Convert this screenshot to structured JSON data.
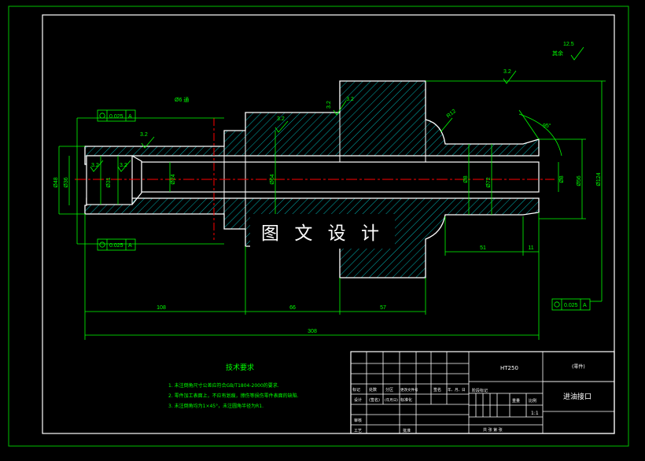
{
  "colors": {
    "outline": "#ffffff",
    "dimension": "#00ff00",
    "hatch": "#00b0b0",
    "centerline": "#ff0000",
    "frame": "#00c000",
    "block": "#ffffff",
    "background": "#000000"
  },
  "watermark": "图 文 设 计",
  "dimensions": {
    "d108": "108",
    "d66": "66",
    "d57": "57",
    "d308": "308",
    "d51": "51",
    "d11": "11",
    "dia_left": "Ø48",
    "dia_bore": "Ø36",
    "dia_inner": "Ø31",
    "dia_24": "Ø24",
    "dia_64": "Ø64",
    "dia_8a": "Ø8",
    "dia_72": "Ø72",
    "dia_8b": "Ø8",
    "dia_56": "Ø56",
    "dia_124": "Ø124",
    "hole": "Ø6 通",
    "angle": "95°",
    "radius": "R12"
  },
  "roughness": {
    "r1": "3.2",
    "r2": "3.2",
    "r3": "3.2",
    "r4": "3.2",
    "r5": "3.2",
    "r6": "3.2",
    "r7": "3.2",
    "other": "12.5",
    "other_label": "其余"
  },
  "tolerances": {
    "t1_value": "0.025",
    "t1_ref": "A",
    "t2_value": "0.025",
    "t2_ref": "A",
    "t3_value": "0.025",
    "t3_ref": "A"
  },
  "notes": {
    "heading": "技术要求",
    "items": [
      "1. 未注倒角尺寸公差应符合GB/T1804-2000的要求.",
      "2. 零件加工表面上，不应有划痕，擦伤等损伤零件表面的缺陷.",
      "3. 未注倒角均为1×45°，未注圆角半径为R1."
    ]
  },
  "title_block": {
    "material": "HT250",
    "label_top": "(零件)",
    "part_name": "进油接口",
    "h_mark": "标记",
    "h_count": "处数",
    "h_zone": "分区",
    "h_doc": "更改文件号",
    "h_sign": "签名",
    "h_date": "年、月、日",
    "designer": "设计",
    "sign": "(签名)",
    "date": "(年月日)",
    "standardize": "标准化",
    "checker": "审核",
    "process": "工艺",
    "approve": "批准",
    "stage": "阶段标记",
    "weight": "重量",
    "scale": "比例",
    "scale_val": "1:1",
    "sheets": "共 张 第 张"
  }
}
